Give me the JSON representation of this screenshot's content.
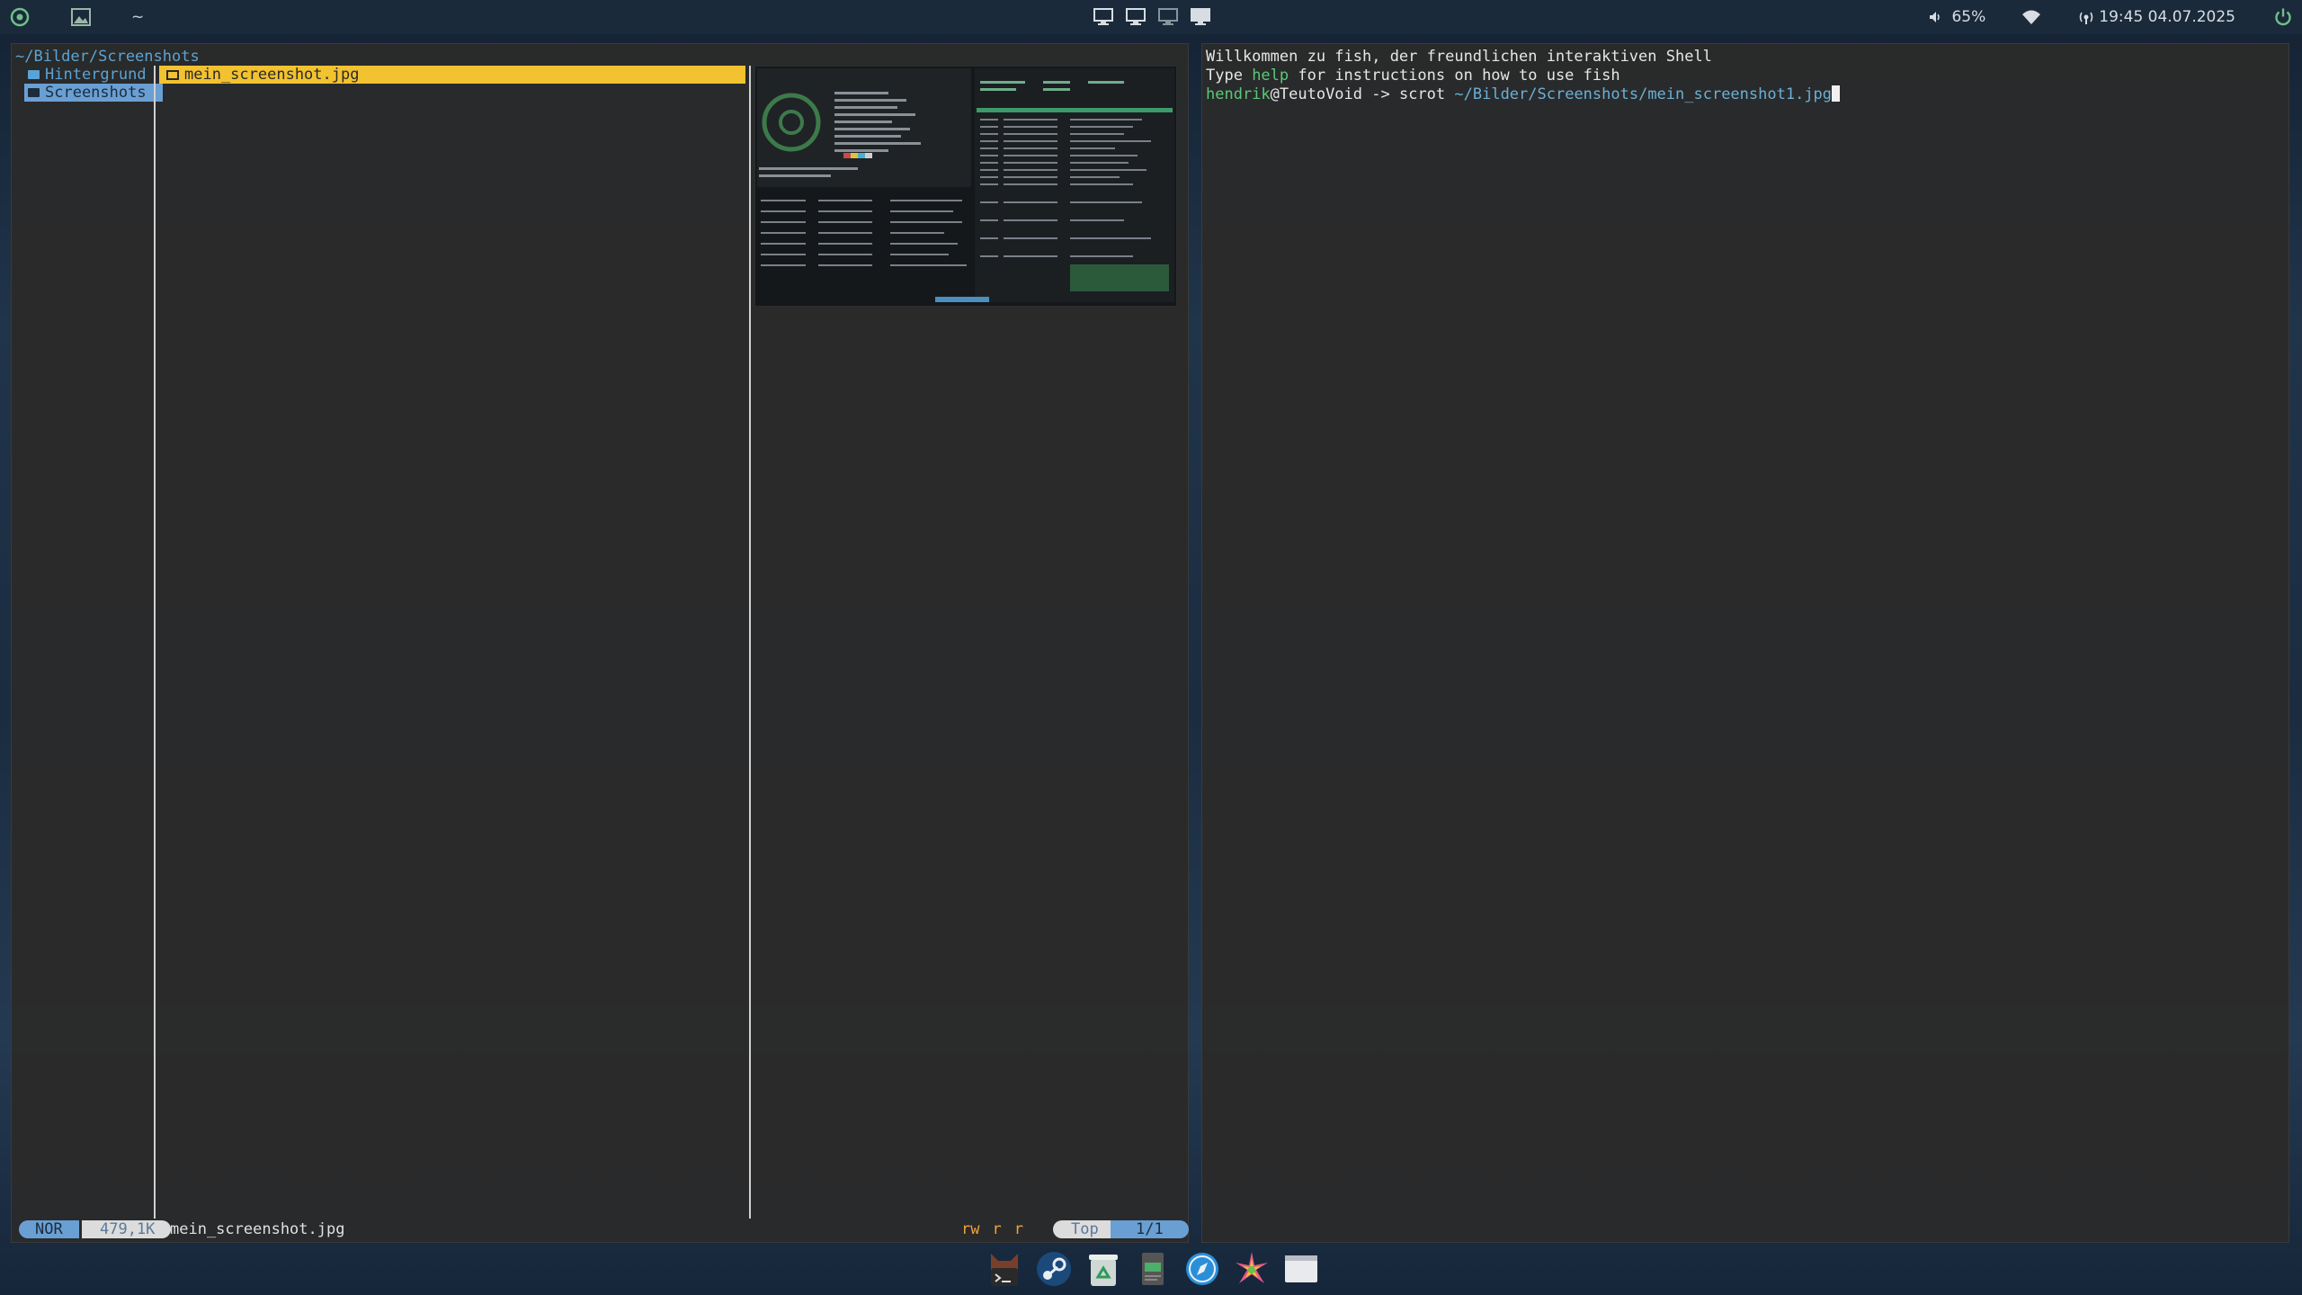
{
  "topbar": {
    "workspace_label": "~",
    "volume": "65%",
    "datetime": "19:45 04.07.2025"
  },
  "file_manager": {
    "path": "~/Bilder/Screenshots",
    "parent_items": [
      {
        "label": "Hintergrund",
        "selected": false
      },
      {
        "label": "Screenshots",
        "selected": true
      }
    ],
    "files": [
      {
        "label": "mein_screenshot.jpg",
        "selected": true
      }
    ],
    "status": {
      "mode": "NOR",
      "size": "479,1K",
      "filename": "mein_screenshot.jpg",
      "permissions": [
        "rw",
        "r",
        "r"
      ],
      "scroll": "Top",
      "position": "1/1"
    }
  },
  "terminal": {
    "welcome": "Willkommen zu fish, der freundlichen interaktiven Shell",
    "help_prefix": "Type ",
    "help_word": "help",
    "help_suffix": " for instructions on how to use fish",
    "prompt_user": "hendrik",
    "prompt_host": "@TeutoVoid",
    "prompt_arrow": " -> ",
    "command": "scrot",
    "argument": " ~/Bilder/Screenshots/mein_screenshot1.jpg"
  },
  "dock": {
    "items": [
      "terminal-app-icon",
      "steam-icon",
      "recycle-app-icon",
      "notes-app-icon",
      "browser-icon",
      "sparkle-app-icon",
      "window-icon"
    ]
  },
  "colors": {
    "accent_blue": "#6a9fd4",
    "highlight_yellow": "#f2c230",
    "prompt_green": "#5bc878",
    "path_teal": "#6ab0d8"
  }
}
